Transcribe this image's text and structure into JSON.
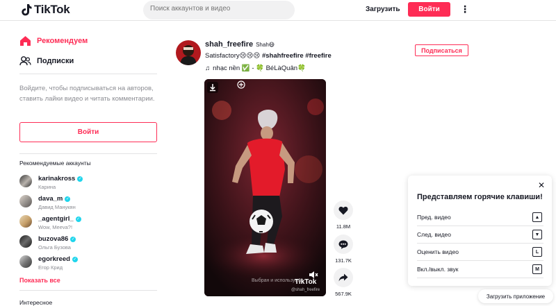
{
  "header": {
    "logo_text": "TikTok",
    "search_placeholder": "Поиск аккаунтов и видео",
    "upload_label": "Загрузить",
    "login_label": "Войти"
  },
  "sidebar": {
    "nav": [
      {
        "label": "Рекомендуем",
        "icon": "home-icon",
        "active": true
      },
      {
        "label": "Подписки",
        "icon": "following-icon",
        "active": false
      }
    ],
    "login_prompt": "Войдите, чтобы подписываться на авторов, ставить лайки видео и читать комментарии.",
    "login_button": "Войти",
    "suggested_title": "Рекомендуемые аккаунты",
    "accounts": [
      {
        "username": "karinakross",
        "name": "Карина"
      },
      {
        "username": "dava_m",
        "name": "Давид Манукян"
      },
      {
        "username": "_agentgirl_",
        "name": "Wow, Meeva?!"
      },
      {
        "username": "buzova86",
        "name": "Ольга Бузова"
      },
      {
        "username": "egorkreed",
        "name": "Егор Крид"
      }
    ],
    "show_all": "Показать все",
    "discover_title": "Интересное"
  },
  "post": {
    "username": "shah_freefire",
    "nickname": "Shah😷",
    "desc_text": "Satisfactory😢😢😢",
    "hashtags": "#shahfreefire #freefire",
    "music": "nhạc nền ✅ - 🍀 BéLàQuân🍀",
    "follow_label": "Подписаться",
    "watermark_text": "Выбран и используеты",
    "watermark_logo": "TikTok",
    "watermark_handle": "@shah_freefire",
    "likes": "11.8M",
    "comments": "131.7K",
    "shares": "567.9K"
  },
  "hotkeys": {
    "title": "Представляем горячие клавиши!",
    "items": [
      {
        "label": "Пред. видео",
        "key": "▲"
      },
      {
        "label": "След. видео",
        "key": "▼"
      },
      {
        "label": "Оценить видео",
        "key": "L"
      },
      {
        "label": "Вкл./выкл. звук",
        "key": "M"
      }
    ]
  },
  "get_app_label": "Загрузить приложение",
  "colors": {
    "accent": "#fe2c55",
    "verified": "#20d5ec"
  }
}
